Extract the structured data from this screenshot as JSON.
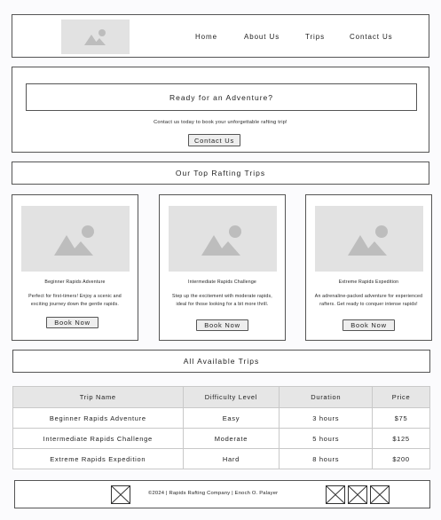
{
  "nav": {
    "links": [
      "Home",
      "About Us",
      "Trips",
      "Contact Us"
    ]
  },
  "hero": {
    "heading": "Ready for an Adventure?",
    "text": "Contact us today to book your unforgettable rafting trip!",
    "button": "Contact Us"
  },
  "top_trips": {
    "title": "Our Top Rafting Trips",
    "cards": [
      {
        "title": "Beginner Rapids Adventure",
        "description": "Perfect for first-timers! Enjoy a scenic and exciting journey down the gentle rapids.",
        "button": "Book Now"
      },
      {
        "title": "Intermediate Rapids Challenge",
        "description": "Step up the excitement with moderate rapids, ideal for those looking for a bit more thrill.",
        "button": "Book Now"
      },
      {
        "title": "Extreme Rapids Expedition",
        "description": "An adrenaline-packed adventure for experienced rafters. Get ready to conquer intense rapids!",
        "button": "Book Now"
      }
    ]
  },
  "all_trips": {
    "title": "All Available Trips",
    "columns": [
      "Trip Name",
      "Difficulty Level",
      "Duration",
      "Price"
    ],
    "rows": [
      [
        "Beginner Rapids Adventure",
        "Easy",
        "3 hours",
        "$75"
      ],
      [
        "Intermediate Rapids Challenge",
        "Moderate",
        "5 hours",
        "$125"
      ],
      [
        "Extreme Rapids Expedition",
        "Hard",
        "8 hours",
        "$200"
      ]
    ]
  },
  "footer": {
    "text": "©2024 | Rapids Rafting Company | Enoch O. Palayer"
  },
  "colors": {
    "border": "#555555",
    "placeholder": "#e2e2e2",
    "table_header": "#e6e6e6"
  },
  "icons": {
    "logo": "image-placeholder-icon",
    "card_image": "image-placeholder-icon",
    "footer_left": "image-missing-icon",
    "social": [
      "image-missing-icon",
      "image-missing-icon",
      "image-missing-icon"
    ]
  }
}
